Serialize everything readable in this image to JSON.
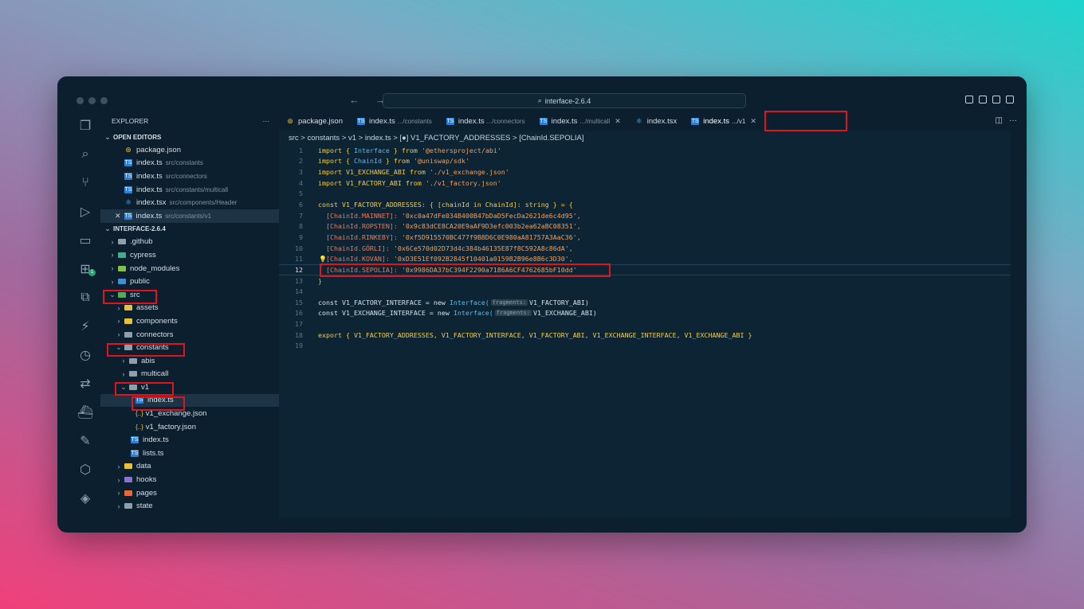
{
  "window": {
    "search": "interface-2.6.4",
    "explorer_title": "EXPLORER",
    "open_editors_label": "OPEN EDITORS",
    "project_label": "INTERFACE-2.6.4",
    "badge": "1"
  },
  "open_editors": [
    {
      "name": "package.json",
      "path": ""
    },
    {
      "name": "index.ts",
      "path": "src/constants"
    },
    {
      "name": "index.ts",
      "path": "src/connectors"
    },
    {
      "name": "index.ts",
      "path": "src/constants/multicall"
    },
    {
      "name": "index.tsx",
      "path": "src/components/Header"
    },
    {
      "name": "index.ts",
      "path": "src/constants/v1"
    }
  ],
  "tree": [
    ".github",
    "cypress",
    "node_modules",
    "public",
    "src",
    "assets",
    "components",
    "connectors",
    "constants",
    "abis",
    "multicall",
    "v1",
    "index.ts",
    "v1_exchange.json",
    "v1_factory.json",
    "index.ts",
    "lists.ts",
    "data",
    "hooks",
    "pages",
    "state"
  ],
  "tabs": [
    {
      "name": "package.json",
      "path": ""
    },
    {
      "name": "index.ts",
      "path": ".../constants"
    },
    {
      "name": "index.ts",
      "path": ".../connectors"
    },
    {
      "name": "index.ts",
      "path": ".../multicall"
    },
    {
      "name": "index.tsx",
      "path": ""
    },
    {
      "name": "index.ts",
      "path": ".../v1"
    }
  ],
  "breadcrumb": "src > constants > v1 > index.ts > [●] V1_FACTORY_ADDRESSES > [ChainId.SEPOLIA]",
  "code": {
    "l1a": "import { ",
    "l1b": "Interface",
    "l1c": " } from ",
    "l1d": "'@ethersproject/abi'",
    "l2a": "import { ",
    "l2b": "ChainId",
    "l2c": " } from ",
    "l2d": "'@uniswap/sdk'",
    "l3a": "import V1_EXCHANGE_ABI from ",
    "l3b": "'./v1_exchange.json'",
    "l4a": "import V1_FACTORY_ABI from ",
    "l4b": "'./v1_factory.json'",
    "l6a": "const V1_FACTORY_ADDRESSES: { [chainId in ChainId]: string } = {",
    "l7a": "  [ChainId.MAINNET]: ",
    "l7b": "'0xc0a47dFe034B400B47bDaD5FecDa2621de6c4d95',",
    "l8a": "  [ChainId.ROPSTEN]: ",
    "l8b": "'0x9c83dCE8CA20E9aAF9D3efc003b2ea62aBC08351',",
    "l9a": "  [ChainId.RINKEBY]: ",
    "l9b": "'0xf5D915570BC477f9B8D6C0E980aA81757A3AaC36',",
    "l10a": "  [ChainId.GÖRLI]: ",
    "l10b": "'0x6Ce570d02D73d4c384b46135E87f8C592A8c86dA',",
    "l11a": "  [ChainId.KOVAN]: ",
    "l11b": "'0xD3E51Ef092B2845f10401a0159B2B96e8B6c3D30',",
    "l12a": "  [ChainId.SEPOLIA]: ",
    "l12b": "'0x9986DA37bC394F2290a7186A6CF4762685bF10dd'",
    "l13a": "}",
    "l15a": "const V1_FACTORY_INTERFACE = new ",
    "l15b": "Interface(",
    "l15h": "fragments:",
    "l15c": "V1_FACTORY_ABI)",
    "l16a": "const V1_EXCHANGE_INTERFACE = new ",
    "l16b": "Interface(",
    "l16h": "fragments:",
    "l16c": "V1_EXCHANGE_ABI)",
    "l18a": "export { V1_FACTORY_ADDRESSES, V1_FACTORY_INTERFACE, V1_FACTORY_ABI, V1_EXCHANGE_INTERFACE, V1_EXCHANGE_ABI }"
  },
  "line_numbers": [
    "1",
    "2",
    "3",
    "4",
    "5",
    "6",
    "7",
    "8",
    "9",
    "10",
    "11",
    "12",
    "13",
    "14",
    "15",
    "16",
    "17",
    "18",
    "19"
  ]
}
